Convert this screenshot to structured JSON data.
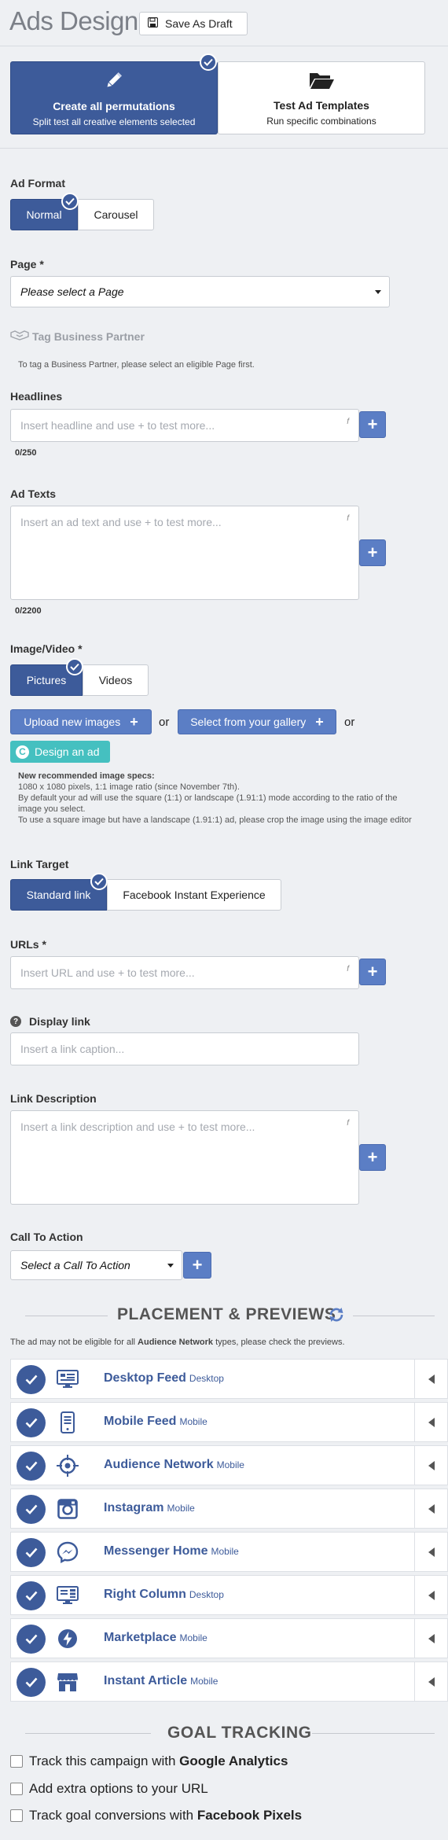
{
  "header": {
    "title": "Ads Design",
    "save_draft_label": "Save As Draft"
  },
  "mode": {
    "create_all": {
      "title": "Create all permutations",
      "subtitle": "Split test all creative elements selected"
    },
    "templates": {
      "title": "Test Ad Templates",
      "subtitle": "Run specific combinations"
    }
  },
  "ad_format": {
    "label": "Ad Format",
    "options": [
      "Normal",
      "Carousel"
    ],
    "selected": "Normal"
  },
  "page": {
    "label": "Page *",
    "value": "Please select a Page"
  },
  "tag_partner": {
    "label": "Tag Business Partner",
    "hint": "To tag a Business Partner, please select an eligible Page first."
  },
  "headlines": {
    "label": "Headlines",
    "placeholder": "Insert headline and use + to test more...",
    "counter": "0/250",
    "mark": "f"
  },
  "ad_texts": {
    "label": "Ad Texts",
    "placeholder": "Insert an ad text and use + to test more...",
    "counter": "0/2200",
    "mark": "f"
  },
  "media": {
    "label": "Image/Video *",
    "options": [
      "Pictures",
      "Videos"
    ],
    "selected": "Pictures",
    "upload_label": "Upload new images",
    "gallery_label": "Select from your gallery",
    "or_text": "or",
    "design_label": "Design an ad",
    "specs_title": "New recommended image specs:",
    "specs_lines": [
      "1080 x 1080 pixels, 1:1 image ratio (since November 7th).",
      "By default your ad will use the square (1:1) or landscape (1.91:1) mode according to the ratio of the",
      "image you select.",
      "To use a square image but have a landscape (1.91:1) ad, please crop the image using the image editor"
    ]
  },
  "link_target": {
    "label": "Link Target",
    "options": [
      "Standard link",
      "Facebook Instant Experience"
    ],
    "selected": "Standard link"
  },
  "urls": {
    "label": "URLs *",
    "placeholder": "Insert URL and use + to test more...",
    "mark": "f"
  },
  "display_link": {
    "label": "Display link",
    "placeholder": "Insert a link caption..."
  },
  "link_description": {
    "label": "Link Description",
    "placeholder": "Insert a link description and use + to test more...",
    "mark": "f"
  },
  "cta": {
    "label": "Call To Action",
    "value": "Select a Call To Action"
  },
  "placement": {
    "title": "PLACEMENT & PREVIEWS",
    "note_prefix": "The ad may not be eligible for all ",
    "note_bold": "Audience Network",
    "note_suffix": " types, please check the previews.",
    "rows": [
      {
        "name": "Desktop Feed",
        "type": "Desktop",
        "icon": "desktop-feed-icon"
      },
      {
        "name": "Mobile Feed",
        "type": "Mobile",
        "icon": "mobile-feed-icon"
      },
      {
        "name": "Audience Network",
        "type": "Mobile",
        "icon": "audience-network-icon"
      },
      {
        "name": "Instagram",
        "type": "Mobile",
        "icon": "instagram-icon"
      },
      {
        "name": "Messenger Home",
        "type": "Mobile",
        "icon": "messenger-icon"
      },
      {
        "name": "Right Column",
        "type": "Desktop",
        "icon": "right-column-icon"
      },
      {
        "name": "Marketplace",
        "type": "Mobile",
        "icon": "marketplace-icon"
      },
      {
        "name": "Instant Article",
        "type": "Mobile",
        "icon": "instant-article-icon"
      }
    ]
  },
  "goal_tracking": {
    "title": "GOAL TRACKING",
    "items": [
      {
        "prefix": "Track this campaign with ",
        "bold": "Google Analytics",
        "checked": false
      },
      {
        "prefix": "Add extra options to your URL",
        "bold": "",
        "checked": false
      },
      {
        "prefix": "Track goal conversions with ",
        "bold": "Facebook Pixels",
        "checked": false
      }
    ]
  },
  "colors": {
    "primary": "#3d5b9a",
    "button": "#5b7ec5",
    "teal": "#45c0c0",
    "background": "#eef0f3"
  }
}
